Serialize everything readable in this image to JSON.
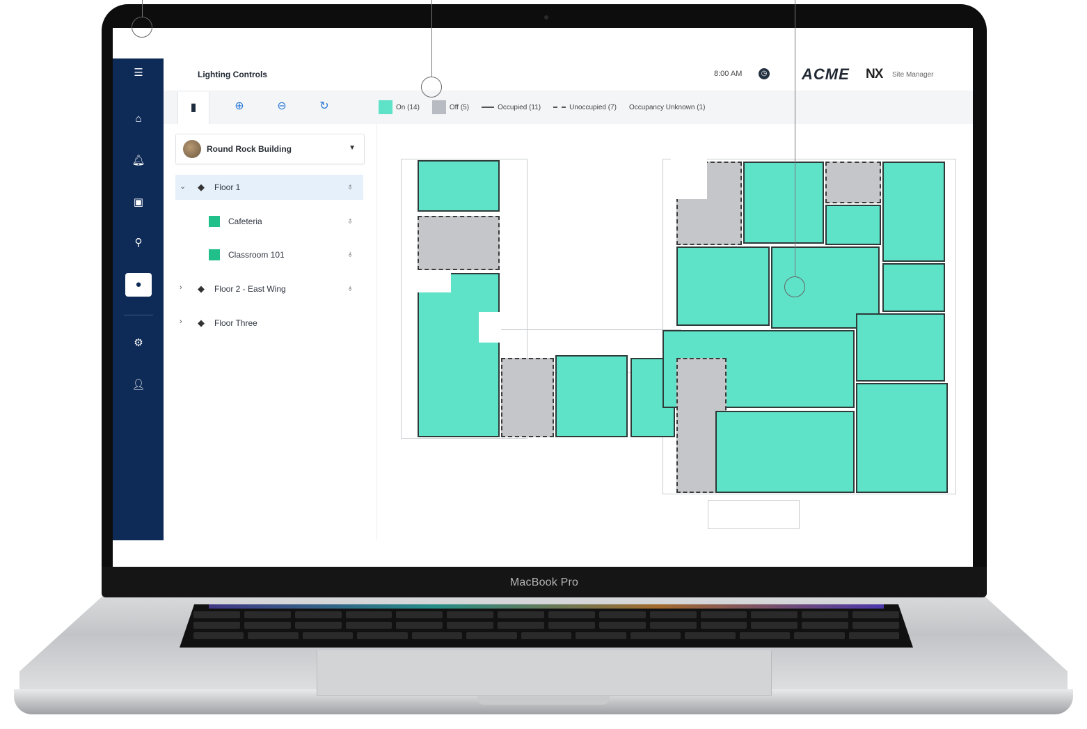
{
  "device": {
    "brand_label": "MacBook Pro"
  },
  "app": {
    "title": "Lighting Controls",
    "time": "8:00 AM",
    "logo_text": "ACME",
    "partner_logo": "NX",
    "partner_label": "Site Manager"
  },
  "sidebar": {
    "items": [
      {
        "icon": "menu-icon"
      },
      {
        "icon": "home-icon"
      },
      {
        "icon": "alerts-icon"
      },
      {
        "icon": "calendar-icon"
      },
      {
        "icon": "location-icon"
      },
      {
        "icon": "lightbulb-icon",
        "active": true
      },
      {
        "icon": "settings-icon"
      },
      {
        "icon": "user-icon"
      }
    ]
  },
  "toolbar": {
    "tools": [
      "building-icon",
      "zoom-in-icon",
      "zoom-out-icon",
      "refresh-icon"
    ]
  },
  "legend": {
    "on": "On (14)",
    "off": "Off (5)",
    "occupied": "Occupied (11)",
    "unoccupied": "Unoccupied (7)",
    "unknown": "Occupancy Unknown (1)"
  },
  "tree": {
    "building": "Round Rock Building",
    "items": [
      {
        "label": "Floor 1",
        "level": 0,
        "expanded": true,
        "selected": true
      },
      {
        "label": "Cafeteria",
        "level": 1
      },
      {
        "label": "Classroom 101",
        "level": 1
      },
      {
        "label": "Floor 2 - East Wing",
        "level": 0,
        "expanded": false
      },
      {
        "label": "Floor Three",
        "level": 0,
        "expanded": false
      }
    ]
  },
  "colors": {
    "sidebar": "#0e2a56",
    "lights_on": "#5ee2c8",
    "lights_off": "#c4c6c9",
    "accent": "#2a7ad8"
  }
}
